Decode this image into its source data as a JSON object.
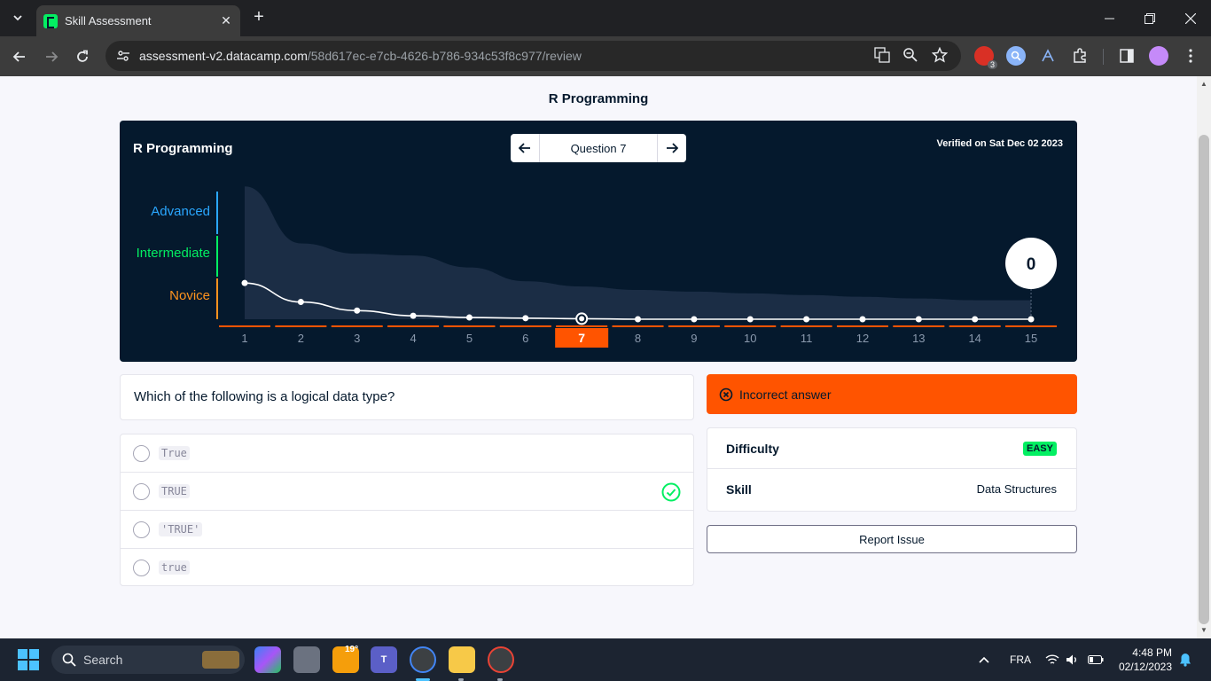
{
  "browser": {
    "tab_title": "Skill Assessment",
    "url_host": "assessment-v2.datacamp.com",
    "url_path": "/58d617ec-e7cb-4626-b786-934c53f8c977/review",
    "extension_badge": "3"
  },
  "page": {
    "heading": "R Programming",
    "panel": {
      "title": "R Programming",
      "verified": "Verified on Sat Dec 02 2023",
      "question_label": "Question 7",
      "score": "0"
    },
    "question": "Which of the following is a logical data type?",
    "options": [
      {
        "label": "True",
        "correct": false
      },
      {
        "label": "TRUE",
        "correct": true
      },
      {
        "label": "'TRUE'",
        "correct": false
      },
      {
        "label": "true",
        "correct": false
      }
    ],
    "result": "Incorrect answer",
    "meta": {
      "difficulty_label": "Difficulty",
      "difficulty_value": "EASY",
      "skill_label": "Skill",
      "skill_value": "Data Structures"
    },
    "report_button": "Report Issue"
  },
  "chart_data": {
    "type": "area",
    "levels": [
      "Advanced",
      "Intermediate",
      "Novice"
    ],
    "level_colors": {
      "Advanced": "#2aa7ff",
      "Intermediate": "#03ef62",
      "Novice": "#ff931e"
    },
    "x": [
      1,
      2,
      3,
      4,
      5,
      6,
      7,
      8,
      9,
      10,
      11,
      12,
      13,
      14,
      15
    ],
    "current_question": 7,
    "score_line": [
      0.21,
      0.1,
      0.05,
      0.02,
      0.01,
      0.006,
      0.003,
      0.0,
      0.0,
      0.0,
      0.0,
      0.0,
      0.0,
      0.0,
      0.0
    ],
    "upper_band": [
      0.77,
      0.44,
      0.38,
      0.37,
      0.3,
      0.22,
      0.19,
      0.17,
      0.16,
      0.15,
      0.14,
      0.13,
      0.12,
      0.11,
      0.11
    ],
    "ylim": [
      0,
      1
    ]
  },
  "taskbar": {
    "search_label": "Search",
    "weather": "19°",
    "language": "FRA",
    "time": "4:48 PM",
    "date": "02/12/2023"
  }
}
